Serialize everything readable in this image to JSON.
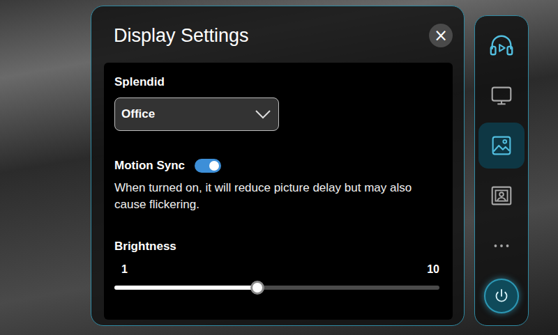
{
  "panel": {
    "title": "Display Settings",
    "close": "×"
  },
  "splendid": {
    "label": "Splendid",
    "value": "Office"
  },
  "motion_sync": {
    "label": "Motion Sync",
    "on": true,
    "description": "When turned on, it will reduce picture delay but may also cause flickering."
  },
  "brightness": {
    "label": "Brightness",
    "min": "1",
    "max": "10",
    "level": 0.44
  },
  "sidebar": {
    "items": [
      {
        "kind": "media",
        "selected": false
      },
      {
        "kind": "display",
        "selected": false
      },
      {
        "kind": "picture",
        "selected": true
      },
      {
        "kind": "theater",
        "selected": false
      },
      {
        "kind": "more",
        "selected": false
      },
      {
        "kind": "power",
        "selected": false
      }
    ]
  }
}
